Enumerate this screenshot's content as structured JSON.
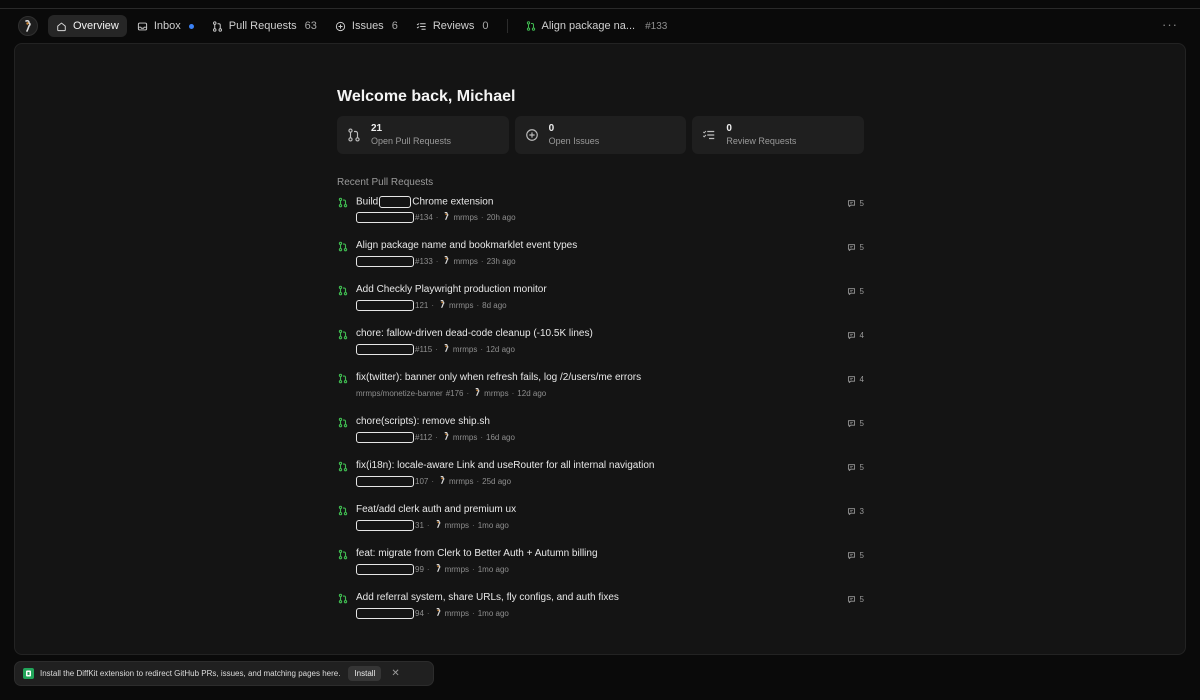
{
  "nav": {
    "items": [
      {
        "name": "nav-overview",
        "icon": "home-icon",
        "label": "Overview",
        "count": "",
        "active": true,
        "dot": false
      },
      {
        "name": "nav-inbox",
        "icon": "inbox-icon",
        "label": "Inbox",
        "count": "",
        "active": false,
        "dot": true
      },
      {
        "name": "nav-pull-requests",
        "icon": "pull-request-icon",
        "label": "Pull Requests",
        "count": "63",
        "active": false,
        "dot": false
      },
      {
        "name": "nav-issues",
        "icon": "issue-icon",
        "label": "Issues",
        "count": "6",
        "active": false,
        "dot": false
      },
      {
        "name": "nav-reviews",
        "icon": "review-icon",
        "label": "Reviews",
        "count": "0",
        "active": false,
        "dot": false
      }
    ],
    "open_pr_tab": {
      "label": "Align package na...",
      "number": "#133"
    },
    "more_icon": "ellipsis-icon",
    "accent_dot_color": "#3b82f6"
  },
  "main": {
    "welcome": "Welcome back, Michael",
    "stats": [
      {
        "name": "stat-open-pull-requests",
        "icon": "pull-request-icon",
        "value": "21",
        "label": "Open Pull Requests"
      },
      {
        "name": "stat-open-issues",
        "icon": "issue-icon",
        "value": "0",
        "label": "Open Issues"
      },
      {
        "name": "stat-review-requests",
        "icon": "review-icon",
        "value": "0",
        "label": "Review Requests"
      }
    ],
    "recent_title": "Recent Pull Requests",
    "pull_requests": [
      {
        "title_before": "Build",
        "title_after": "Chrome extension",
        "title_redacted": true,
        "repo": "",
        "number": "#134",
        "author": "mrmps",
        "age": "20h ago",
        "comments": "5"
      },
      {
        "title": "Align package name and bookmarklet event types",
        "repo": "",
        "number": "#133",
        "author": "mrmps",
        "age": "23h ago",
        "comments": "5"
      },
      {
        "title": "Add Checkly Playwright production monitor",
        "repo": "",
        "number": "121",
        "author": "mrmps",
        "age": "8d ago",
        "comments": "5"
      },
      {
        "title": "chore: fallow-driven dead-code cleanup (-10.5K lines)",
        "repo": "",
        "number": "#115",
        "author": "mrmps",
        "age": "12d ago",
        "comments": "4"
      },
      {
        "title": "fix(twitter): banner only when refresh fails, log /2/users/me errors",
        "repo": "mrmps/monetize-banner",
        "number": "#176",
        "author": "mrmps",
        "age": "12d ago",
        "comments": "4"
      },
      {
        "title": "chore(scripts): remove ship.sh",
        "repo": "",
        "number": "#112",
        "author": "mrmps",
        "age": "16d ago",
        "comments": "5"
      },
      {
        "title": "fix(i18n): locale-aware Link and useRouter for all internal navigation",
        "repo": "",
        "number": "107",
        "author": "mrmps",
        "age": "25d ago",
        "comments": "5"
      },
      {
        "title": "Feat/add clerk auth and premium ux",
        "repo": "",
        "number": "31",
        "author": "mrmps",
        "age": "1mo ago",
        "comments": "3"
      },
      {
        "title": "feat: migrate from Clerk to Better Auth + Autumn billing",
        "repo": "",
        "number": "99",
        "author": "mrmps",
        "age": "1mo ago",
        "comments": "5"
      },
      {
        "title": "Add referral system, share URLs, fly configs, and auth fixes",
        "repo": "",
        "number": "94",
        "author": "mrmps",
        "age": "1mo ago",
        "comments": "5"
      }
    ],
    "pr_icon_color": "#3fb950"
  },
  "toast": {
    "text": "Install the DiffKit extension to redirect GitHub PRs, issues, and matching pages here.",
    "button": "Install",
    "close": "✕",
    "brand_color": "#22a55a"
  }
}
